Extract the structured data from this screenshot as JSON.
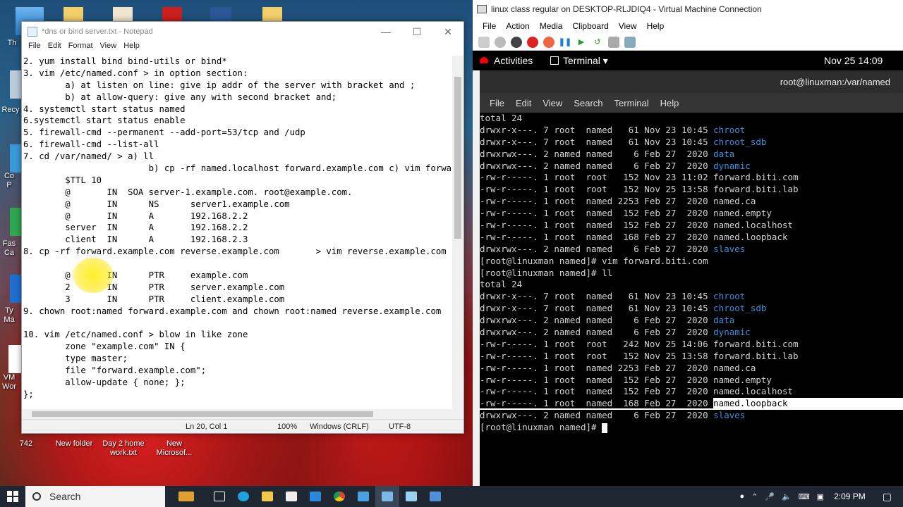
{
  "desktop": {
    "icons": [
      {
        "label": "Th"
      },
      {
        "label": "Recy"
      },
      {
        "label": "Co\nP"
      },
      {
        "label": "Fas\nCa"
      },
      {
        "label": "Ty\nMa"
      },
      {
        "label": "VM\nWor"
      },
      {
        "label": "742"
      },
      {
        "label": "New folder"
      },
      {
        "label": "Day 2 home\nwork.txt"
      },
      {
        "label": "New\nMicrosof..."
      }
    ]
  },
  "notepad": {
    "title": "*dns or bind server.txt - Notepad",
    "menu": [
      "File",
      "Edit",
      "Format",
      "View",
      "Help"
    ],
    "lines": [
      "2. yum install bind bind-utils or bind*",
      "3. vim /etc/named.conf > in option section:",
      "        a) at listen on line: give ip addr of the server with bracket and ;",
      "        b) at allow-query: give any with second bracket and;",
      "4. systemctl start status named",
      "6.systemctl start status enable",
      "5. firewall-cmd --permanent --add-port=53/tcp and /udp",
      "6. firewall-cmd --list-all",
      "7. cd /var/named/ > a) ll",
      "                        b) cp -rf named.localhost forward.example.com c) vim forward.",
      "        $TTL 10",
      "        @       IN  SOA server-1.example.com. root@example.com.",
      "        @       IN      NS      server1.example.com",
      "        @       IN      A       192.168.2.2",
      "        server  IN      A       192.168.2.2",
      "        client  IN      A       192.168.2.3",
      "8. cp -rf forward.example.com reverse.example.com       > vim reverse.example.com",
      "",
      "        @       IN      PTR     example.com",
      "        2       IN      PTR     server.example.com",
      "        3       IN      PTR     client.example.com",
      "9. chown root:named forward.example.com and chown root:named reverse.example.com",
      "",
      "10. vim /etc/named.conf > blow in like zone",
      "        zone \"example.com\" IN {",
      "        type master;",
      "        file \"forward.example.com\";",
      "        allow-update { none; };",
      "};"
    ],
    "status": {
      "position": "Ln 20, Col 1",
      "zoom": "100%",
      "line_ending": "Windows (CRLF)",
      "encoding": "UTF-8"
    }
  },
  "vm": {
    "title": "linux class regular on DESKTOP-RLJDIQ4 - Virtual Machine Connection",
    "menu": [
      "File",
      "Action",
      "Media",
      "Clipboard",
      "View",
      "Help"
    ],
    "gnome": {
      "activities": "Activities",
      "app": "Terminal ▾",
      "clock": "Nov 25  14:09"
    },
    "terminal": {
      "title": "root@linuxman:/var/named",
      "menu": [
        "File",
        "Edit",
        "View",
        "Search",
        "Terminal",
        "Help"
      ],
      "lines": [
        {
          "text": "total 24"
        },
        {
          "text": "drwxr-x---. 7 root  named   61 Nov 23 10:45 ",
          "name": "chroot",
          "color": "blue"
        },
        {
          "text": "drwxr-x---. 7 root  named   61 Nov 23 10:45 ",
          "name": "chroot_sdb",
          "color": "blue"
        },
        {
          "text": "drwxrwx---. 2 named named    6 Feb 27  2020 ",
          "name": "data",
          "color": "blue"
        },
        {
          "text": "drwxrwx---. 2 named named    6 Feb 27  2020 ",
          "name": "dynamic",
          "color": "blue"
        },
        {
          "text": "-rw-r-----. 1 root  root   152 Nov 23 11:02 ",
          "name": "forward.biti.com"
        },
        {
          "text": "-rw-r-----. 1 root  root   152 Nov 25 13:58 ",
          "name": "forward.biti.lab"
        },
        {
          "text": "-rw-r-----. 1 root  named 2253 Feb 27  2020 ",
          "name": "named.ca"
        },
        {
          "text": "-rw-r-----. 1 root  named  152 Feb 27  2020 ",
          "name": "named.empty"
        },
        {
          "text": "-rw-r-----. 1 root  named  152 Feb 27  2020 ",
          "name": "named.localhost"
        },
        {
          "text": "-rw-r-----. 1 root  named  168 Feb 27  2020 ",
          "name": "named.loopback"
        },
        {
          "text": "drwxrwx---. 2 named named    6 Feb 27  2020 ",
          "name": "slaves",
          "color": "blue"
        },
        {
          "text": "[root@linuxman named]# vim forward.biti.com"
        },
        {
          "text": "[root@linuxman named]# ll"
        },
        {
          "text": "total 24"
        },
        {
          "text": "drwxr-x---. 7 root  named   61 Nov 23 10:45 ",
          "name": "chroot",
          "color": "blue"
        },
        {
          "text": "drwxr-x---. 7 root  named   61 Nov 23 10:45 ",
          "name": "chroot_sdb",
          "color": "blue"
        },
        {
          "text": "drwxrwx---. 2 named named    6 Feb 27  2020 ",
          "name": "data",
          "color": "blue"
        },
        {
          "text": "drwxrwx---. 2 named named    6 Feb 27  2020 ",
          "name": "dynamic",
          "color": "blue"
        },
        {
          "text": "-rw-r-----. 1 root  root   242 Nov 25 14:06 ",
          "name": "forward.biti.com"
        },
        {
          "text": "-rw-r-----. 1 root  root   152 Nov 25 13:58 ",
          "name": "forward.biti.lab"
        },
        {
          "text": "-rw-r-----. 1 root  named 2253 Feb 27  2020 ",
          "name": "named.ca"
        },
        {
          "text": "-rw-r-----. 1 root  named  152 Feb 27  2020 ",
          "name": "named.empty"
        },
        {
          "text": "-rw-r-----. 1 root  named  152 Feb 27  2020 ",
          "name": "named.localhost"
        },
        {
          "text": "-rw-r-----. 1 root  named  168 Feb 27  2020 ",
          "name": "named.loopback",
          "color": "selected"
        },
        {
          "text": "drwxrwx---. 2 named named    6 Feb 27  2020 ",
          "name": "slaves",
          "color": "blue"
        },
        {
          "text": "[root@linuxman named]# ",
          "cursor": true
        }
      ]
    }
  },
  "taskbar": {
    "search": "Search",
    "time": "2:09 PM"
  },
  "colors": {
    "term_blue": "#3c8fdd",
    "taskbar": "#1f2733"
  }
}
